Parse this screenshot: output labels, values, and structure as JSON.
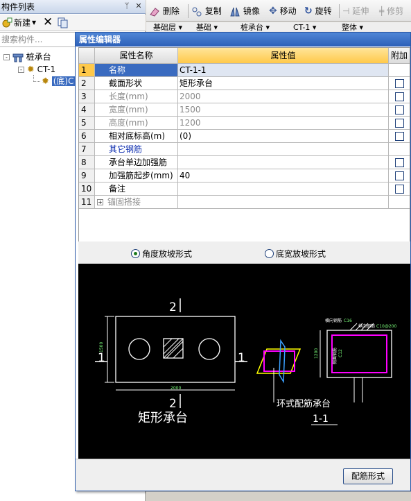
{
  "left_panel": {
    "title": "构件列表",
    "pin_glyph": "ᛘ",
    "close_glyph": "✕",
    "new_label": "新建",
    "search_placeholder": "搜索构件...",
    "tree": [
      {
        "label": "桩承台",
        "expander": "-",
        "icon": "pile-cap-icon"
      },
      {
        "label": "CT-1",
        "expander": "-",
        "icon": "gear-icon"
      },
      {
        "label": "(底)C",
        "icon": "gear-icon"
      }
    ]
  },
  "toolbar": {
    "delete_label": "删除",
    "copy_label": "复制",
    "mirror_label": "镜像",
    "move_label": "移动",
    "rotate_label": "旋转",
    "extend_label": "延伸",
    "trim_label": "修剪",
    "filters": [
      "基础层",
      "基础",
      "桩承台",
      "CT-1",
      "整体"
    ]
  },
  "dialog": {
    "title": "属性编辑器",
    "columns": {
      "name": "属性名称",
      "value": "属性值",
      "extra": "附加"
    },
    "rows": [
      {
        "num": "1",
        "name": "名称",
        "value": "CT-1-1",
        "check": false,
        "selected": true
      },
      {
        "num": "2",
        "name": "截面形状",
        "value": "矩形承台",
        "check": true
      },
      {
        "num": "3",
        "name": "长度(mm)",
        "value": "2000",
        "check": true,
        "disabled": true
      },
      {
        "num": "4",
        "name": "宽度(mm)",
        "value": "1500",
        "check": true,
        "disabled": true
      },
      {
        "num": "5",
        "name": "高度(mm)",
        "value": "1200",
        "check": true,
        "disabled": true
      },
      {
        "num": "6",
        "name": "相对底标高(m)",
        "value": "(0)",
        "check": true
      },
      {
        "num": "7",
        "name": "其它钢筋",
        "value": "",
        "check": false,
        "link": true
      },
      {
        "num": "8",
        "name": "承台单边加强筋",
        "value": "",
        "check": true
      },
      {
        "num": "9",
        "name": "加强筋起步(mm)",
        "value": "40",
        "check": true
      },
      {
        "num": "10",
        "name": "备注",
        "value": "",
        "check": true
      },
      {
        "num": "11",
        "name": "锚固搭接",
        "value": "",
        "check": false,
        "expander": "+",
        "disabled": true
      }
    ],
    "radio_angle": "角度放坡形式",
    "radio_width": "底宽放坡形式",
    "radio_selected": "angle",
    "rebar_button": "配筋形式"
  },
  "preview": {
    "section_label_top": "2",
    "section_label_left": "1",
    "section_label_right": "1",
    "section_label_bottom": "2",
    "plan_caption": "矩形承台",
    "dim_length": "2000",
    "dim_width": "1500",
    "ring_caption": "环式配筋承台",
    "section_caption": "1-1",
    "annot_horizontal": "横向钢筋",
    "annot_horizontal_val": "C16",
    "annot_longitudinal": "纵向钢筋",
    "annot_longitudinal_val": "C10@200",
    "annot_side": "侧面钢筋",
    "annot_side_val": "C12",
    "annot_height": "1200",
    "colors": {
      "background": "#000000",
      "lines": "#ffffff",
      "rebar": "#ff00ff",
      "stirrup": "#ffff00",
      "dim": "#00cc00"
    }
  }
}
